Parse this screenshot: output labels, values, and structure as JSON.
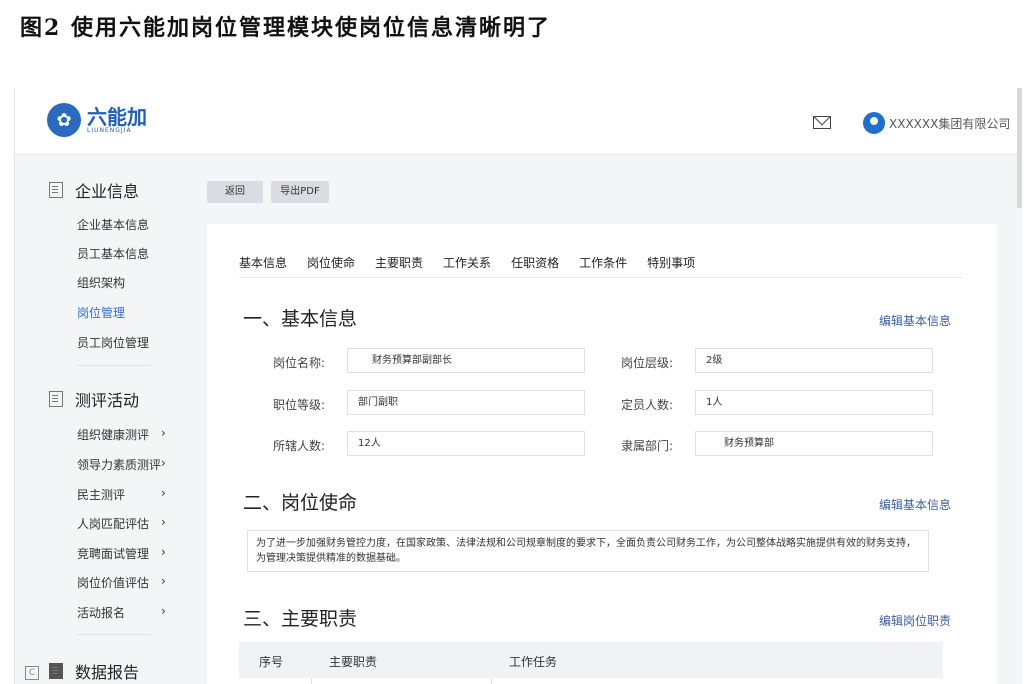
{
  "caption": "图2 使用六能加岗位管理模块使岗位信息清晰明了",
  "header": {
    "logo_cn": "六能加",
    "logo_en": "LIUNENGJIA",
    "company": "XXXXXX集团有限公司"
  },
  "sidebar": {
    "sections": [
      {
        "title": "企业信息",
        "items": [
          "企业基本信息",
          "员工基本信息",
          "组织架构",
          "岗位管理",
          "员工岗位管理"
        ]
      },
      {
        "title": "测评活动",
        "items": [
          "组织健康测评",
          "领导力素质测评",
          "民主测评",
          "人岗匹配评估",
          "竞聘面试管理",
          "岗位价值评估",
          "活动报名"
        ]
      },
      {
        "title": "数据报告",
        "items": []
      }
    ],
    "arrow": "›",
    "badge": "C"
  },
  "toolbar": {
    "back": "返回",
    "export": "导出PDF"
  },
  "tabs": [
    "基本信息",
    "岗位使命",
    "主要职责",
    "工作关系",
    "任职资格",
    "工作条件",
    "特别事项"
  ],
  "basic": {
    "title": "一、基本信息",
    "edit": "编辑基本信息",
    "fields": [
      {
        "label": "岗位名称:",
        "value": "财务预算部副部长"
      },
      {
        "label": "岗位层级:",
        "value": "2级"
      },
      {
        "label": "职位等级:",
        "value": "部门副职"
      },
      {
        "label": "定员人数:",
        "value": "1人"
      },
      {
        "label": "所辖人数:",
        "value": "12人"
      },
      {
        "label": "隶属部门:",
        "value": "财务预算部"
      }
    ]
  },
  "mission": {
    "title": "二、岗位使命",
    "edit": "编辑基本信息",
    "text": "为了进一步加强财务管控力度，在国家政策、法律法规和公司规章制度的要求下，全面负责公司财务工作，为公司整体战略实施提供有效的财务支持，为管理决策提供精准的数据基础。"
  },
  "duties": {
    "title": "三、主要职责",
    "edit": "编辑岗位职责",
    "columns": [
      "序号",
      "主要职责",
      "工作任务"
    ]
  }
}
